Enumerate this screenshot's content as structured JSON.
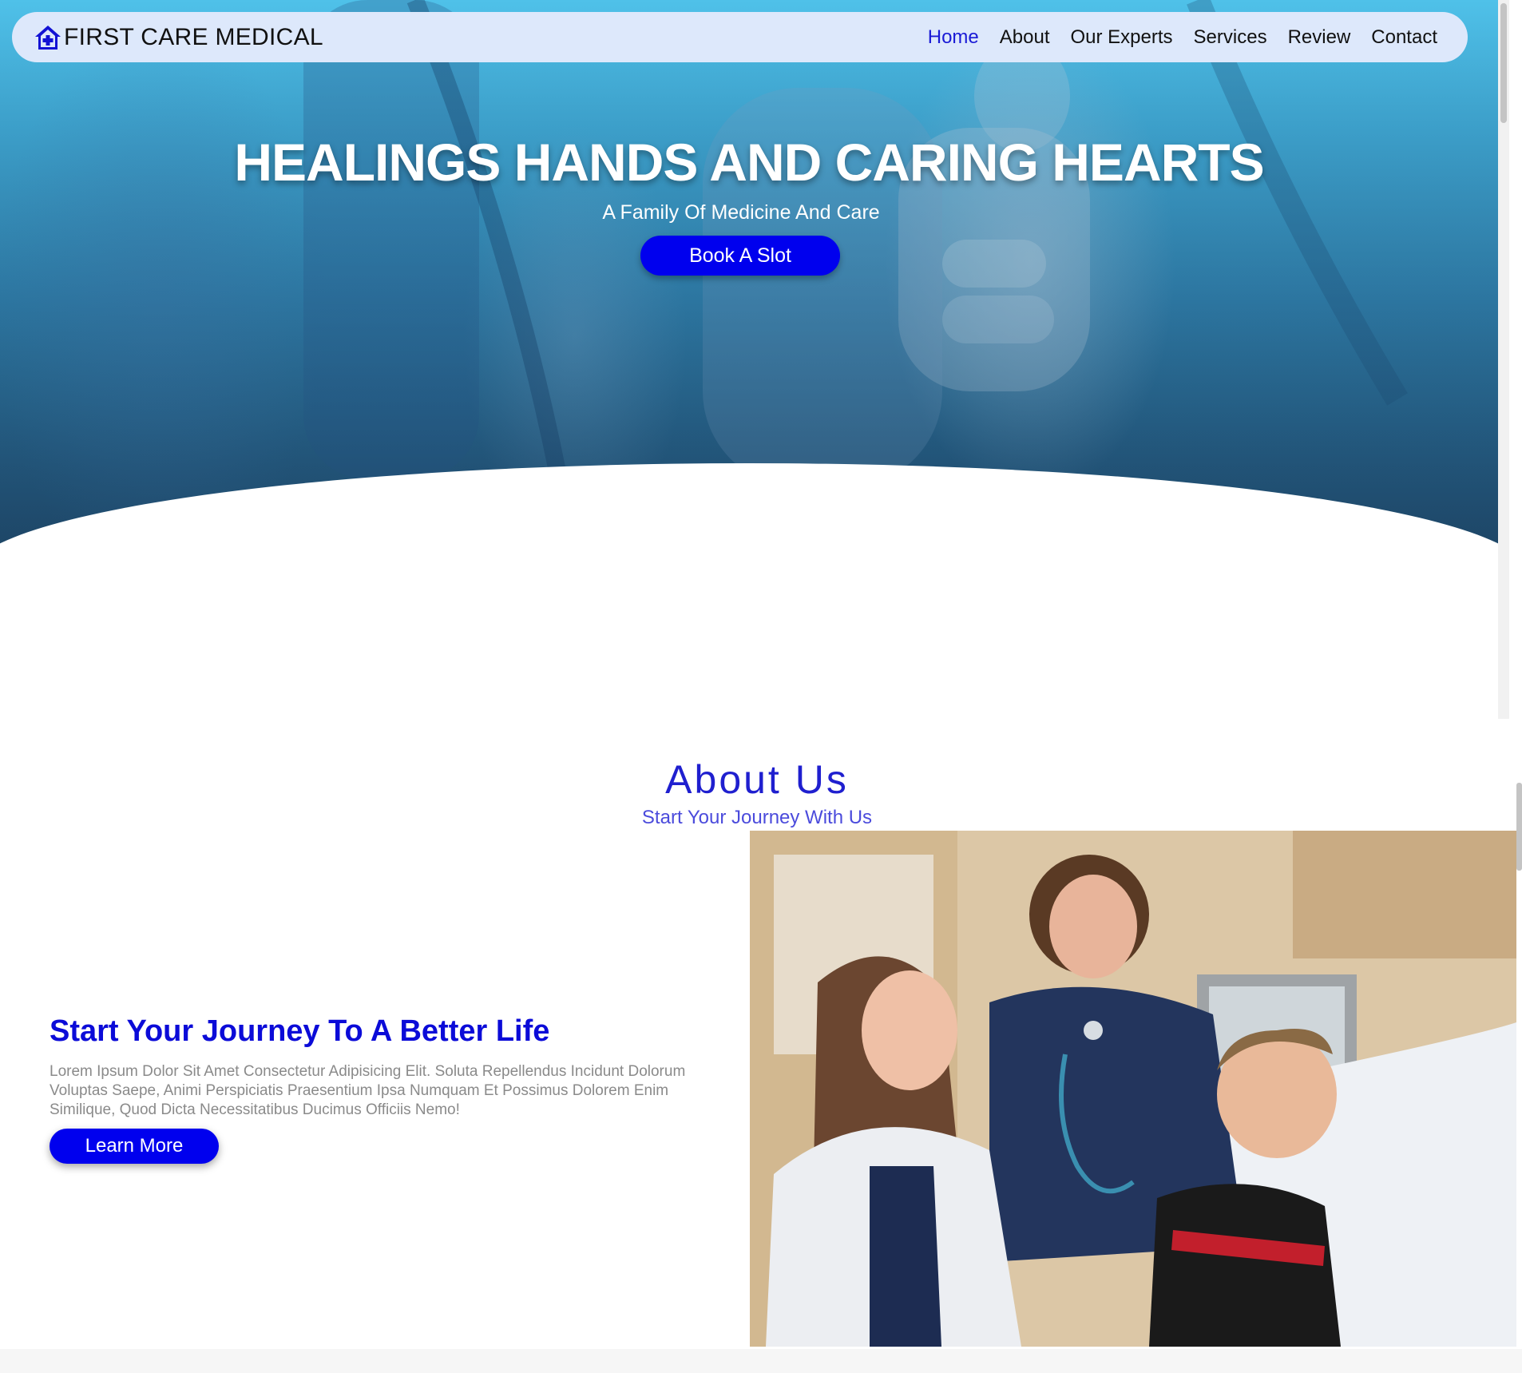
{
  "navbar": {
    "brand": "FIRST CARE MEDICAL",
    "links": [
      {
        "label": "Home",
        "active": true
      },
      {
        "label": "About",
        "active": false
      },
      {
        "label": "Our Experts",
        "active": false
      },
      {
        "label": "Services",
        "active": false
      },
      {
        "label": "Review",
        "active": false
      },
      {
        "label": "Contact",
        "active": false
      }
    ]
  },
  "hero": {
    "title": "HEALINGS HANDS AND CARING HEARTS",
    "subtitle": "A Family Of Medicine And Care",
    "cta_label": "Book A Slot"
  },
  "about": {
    "title": "About Us",
    "subtitle": "Start Your Journey With Us",
    "heading": "Start Your Journey To A Better Life",
    "text": "Lorem Ipsum Dolor Sit Amet Consectetur Adipisicing Elit. Soluta Repellendus Incidunt Dolorum Voluptas Saepe, Animi Perspiciatis Praesentium Ipsa Numquam Et Possimus Dolorem Enim Similique, Quod Dicta Necessitatibus Ducimus Officiis Nemo!",
    "button_label": "Learn More"
  },
  "colors": {
    "accent": "#0000ee",
    "nav_active": "#1a1ad6",
    "navbar_bg": "#dde8fb",
    "heading_blue": "#0b0bd8"
  },
  "icons": {
    "logo": "house-medical-icon"
  }
}
